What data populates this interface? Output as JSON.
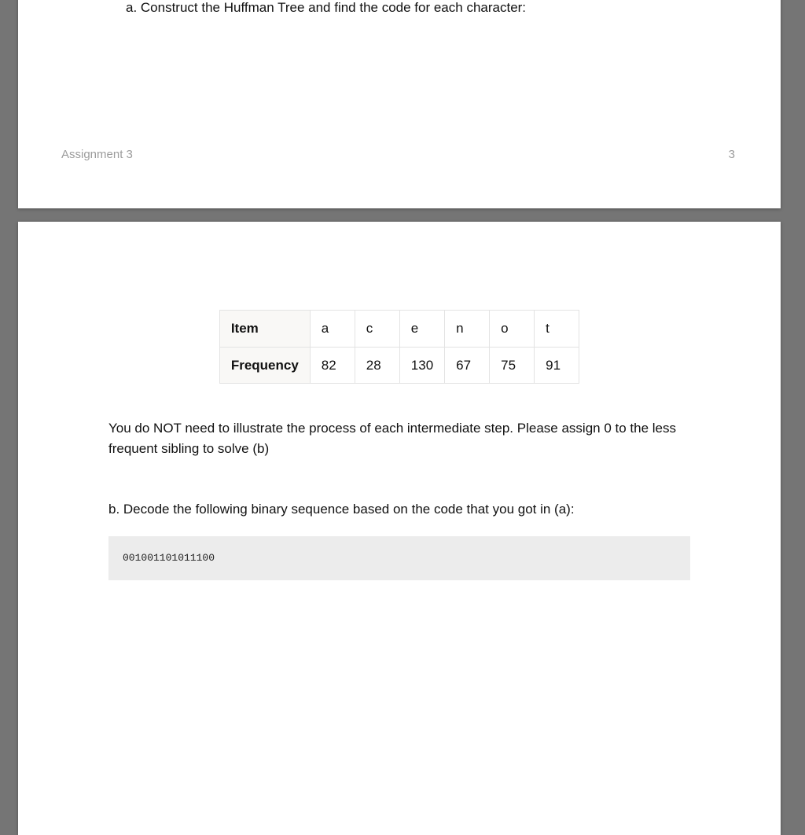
{
  "page1": {
    "question_a": "a.  Construct the Huffman Tree and find the code for each character:",
    "footer_left": "Assignment 3",
    "footer_right": "3"
  },
  "page2": {
    "table": {
      "row1_label": "Item",
      "row2_label": "Frequency",
      "cols": [
        "a",
        "c",
        "e",
        "n",
        "o",
        "t"
      ],
      "freq": [
        "82",
        "28",
        "130",
        "67",
        "75",
        "91"
      ]
    },
    "paragraph": "You do NOT need to illustrate the process of each intermediate step. Please assign 0 to the less frequent sibling to solve (b)",
    "part_b": "b. Decode the following binary sequence based on the code that you got in (a):",
    "code": "001001101011100"
  }
}
